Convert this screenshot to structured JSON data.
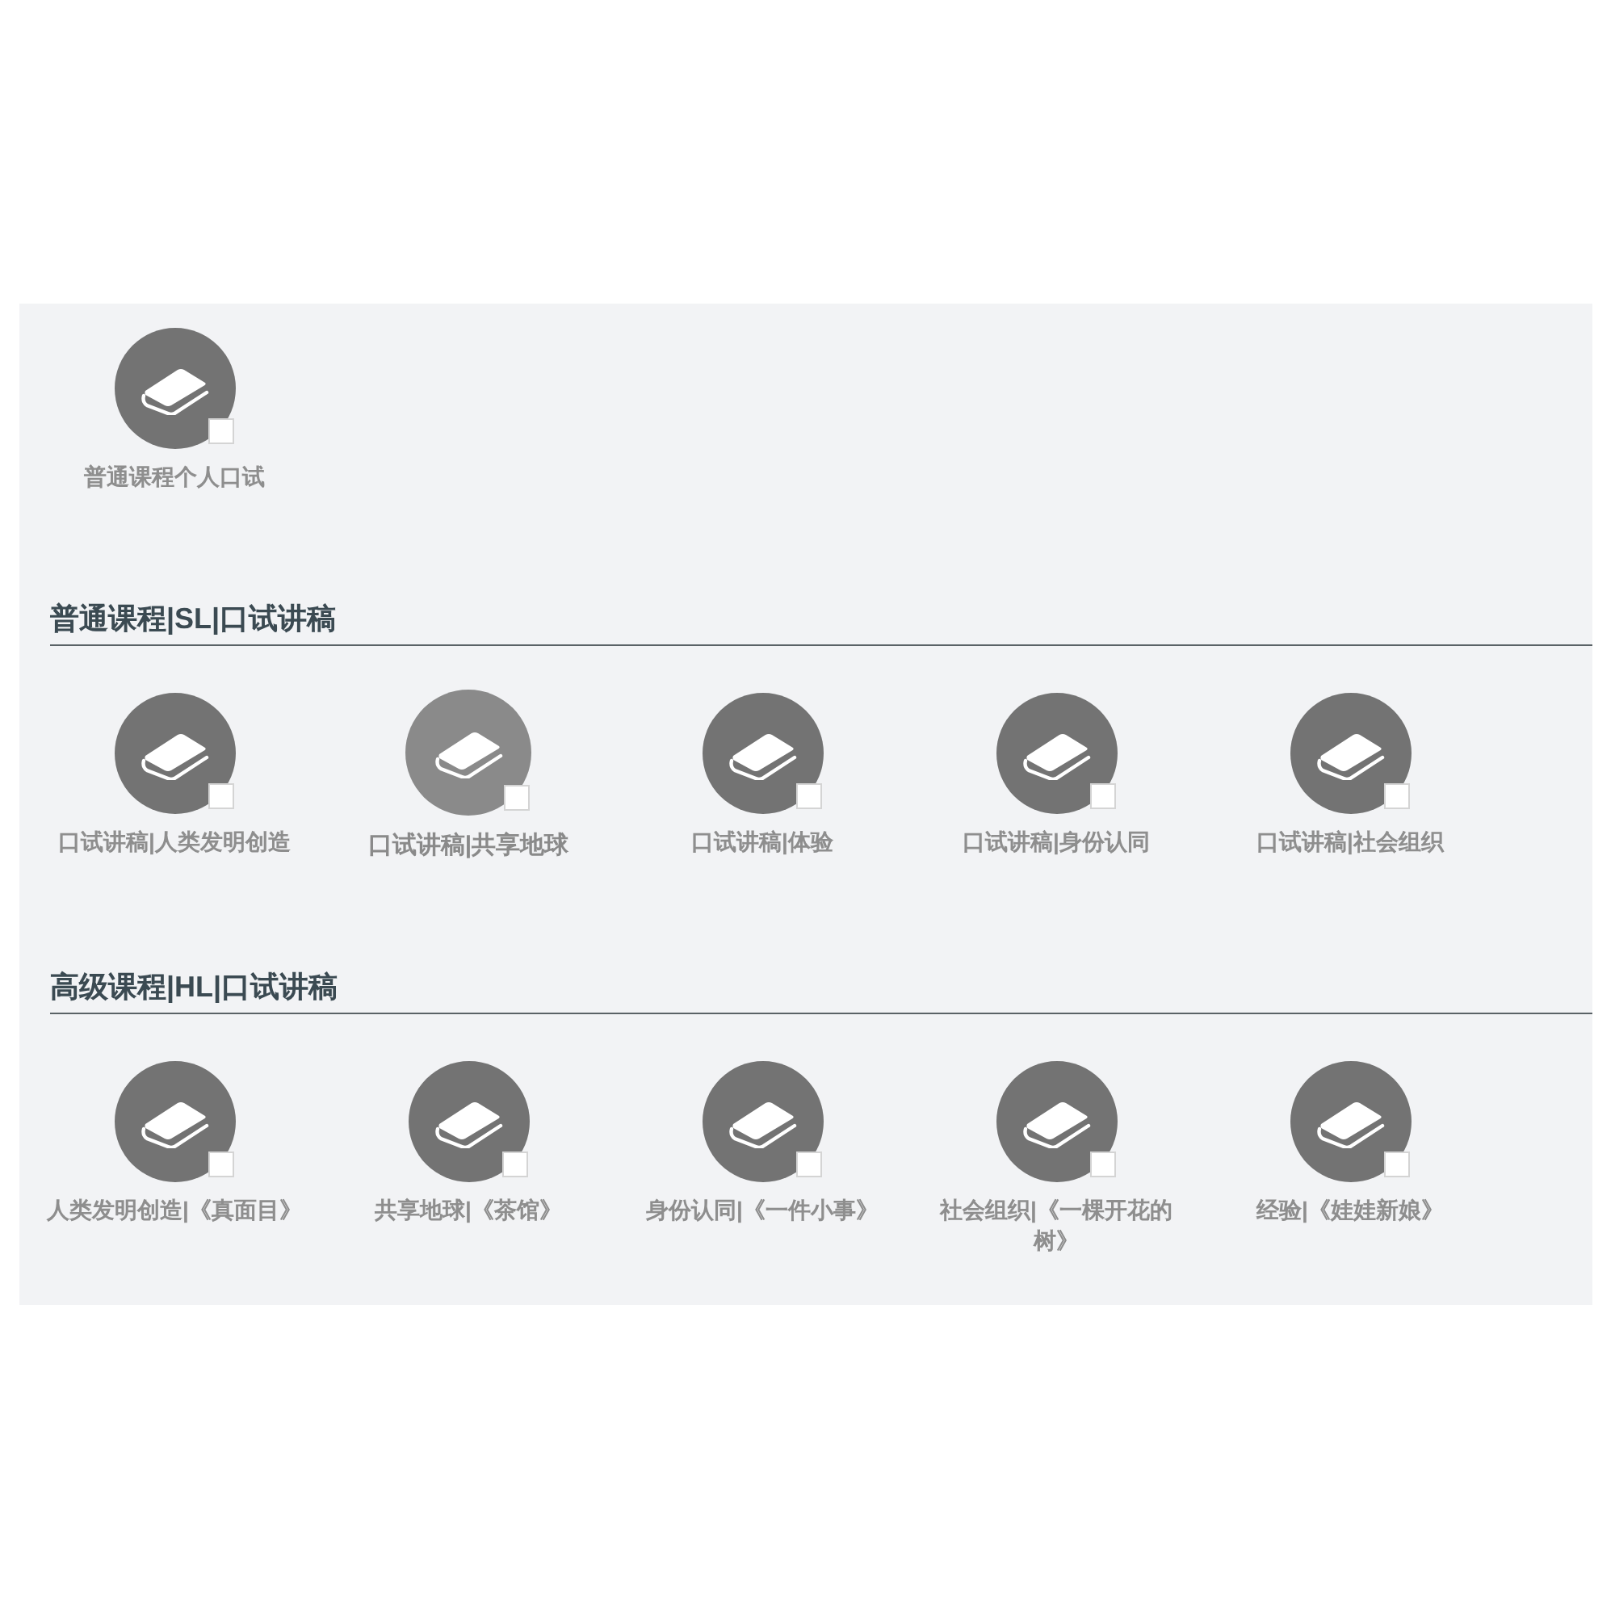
{
  "groups": [
    {
      "items": [
        {
          "label": "普通课程个人口试",
          "checked": false,
          "highlighted": false
        }
      ]
    },
    {
      "heading": "普通课程|SL|口试讲稿",
      "items": [
        {
          "label": "口试讲稿|人类发明创造",
          "checked": false,
          "highlighted": false
        },
        {
          "label": "口试讲稿|共享地球",
          "checked": false,
          "highlighted": true
        },
        {
          "label": "口试讲稿|体验",
          "checked": false,
          "highlighted": false
        },
        {
          "label": "口试讲稿|身份认同",
          "checked": false,
          "highlighted": false
        },
        {
          "label": "口试讲稿|社会组织",
          "checked": false,
          "highlighted": false
        }
      ]
    },
    {
      "heading": "高级课程|HL|口试讲稿",
      "items": [
        {
          "label": "人类发明创造|《真面目》",
          "checked": false,
          "highlighted": false
        },
        {
          "label": "共享地球|《茶馆》",
          "checked": false,
          "highlighted": false
        },
        {
          "label": "身份认同|《一件小事》",
          "checked": false,
          "highlighted": false
        },
        {
          "label": "社会组织|《一棵开花的树》",
          "checked": false,
          "highlighted": false
        },
        {
          "label": "经验|《娃娃新娘》",
          "checked": false,
          "highlighted": false
        }
      ]
    }
  ]
}
